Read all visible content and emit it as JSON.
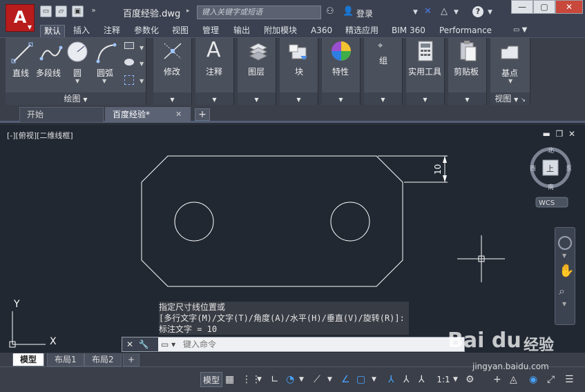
{
  "titlebar": {
    "app_logo": "A",
    "doc_title": "百度经验.dwg",
    "search_placeholder": "键入关键字或短语",
    "login_label": "登录",
    "help_label": "?"
  },
  "ribbon_tabs": [
    "默认",
    "插入",
    "注释",
    "参数化",
    "视图",
    "管理",
    "输出",
    "附加模块",
    "A360",
    "精选应用",
    "BIM 360",
    "Performance"
  ],
  "panels": {
    "draw": {
      "tools": [
        "直线",
        "多段线",
        "圆",
        "圆弧"
      ],
      "footer": "绘图"
    },
    "modify": {
      "label": "修改"
    },
    "annotate": {
      "label": "注释"
    },
    "layers": {
      "label": "图层"
    },
    "block": {
      "label": "块"
    },
    "properties": {
      "label": "特性"
    },
    "group": {
      "label": "组"
    },
    "utilities": {
      "label": "实用工具"
    },
    "clipboard": {
      "label": "剪贴板"
    },
    "view": {
      "base_label": "基点",
      "footer": "视图"
    }
  },
  "doc_tabs": {
    "start": "开始",
    "active": "百度经验*"
  },
  "viewport": {
    "label": "[-][俯视][二维线框]",
    "dimension_value": "10",
    "viewcube": {
      "north": "北",
      "south": "南",
      "east": "东",
      "west": "西",
      "face": "上",
      "wcs": "WCS"
    },
    "ucs": {
      "x": "X",
      "y": "Y"
    }
  },
  "command": {
    "history": [
      "指定尺寸线位置或",
      "[多行文字(M)/文字(T)/角度(A)/水平(H)/垂直(V)/旋转(R)]:",
      "标注文字 = 10"
    ],
    "placeholder": "键入命令"
  },
  "layout_tabs": [
    "模型",
    "布局1",
    "布局2"
  ],
  "status": {
    "model": "模型",
    "scale": "1:1"
  },
  "watermark": {
    "logo": "Bai du",
    "text": "经验",
    "url": "jingyan.baidu.com"
  },
  "colors": {
    "canvas_bg": "#212832",
    "ribbon_bg": "#4a505c",
    "accent": "#b81c1c",
    "dimension": "#ffffff"
  }
}
